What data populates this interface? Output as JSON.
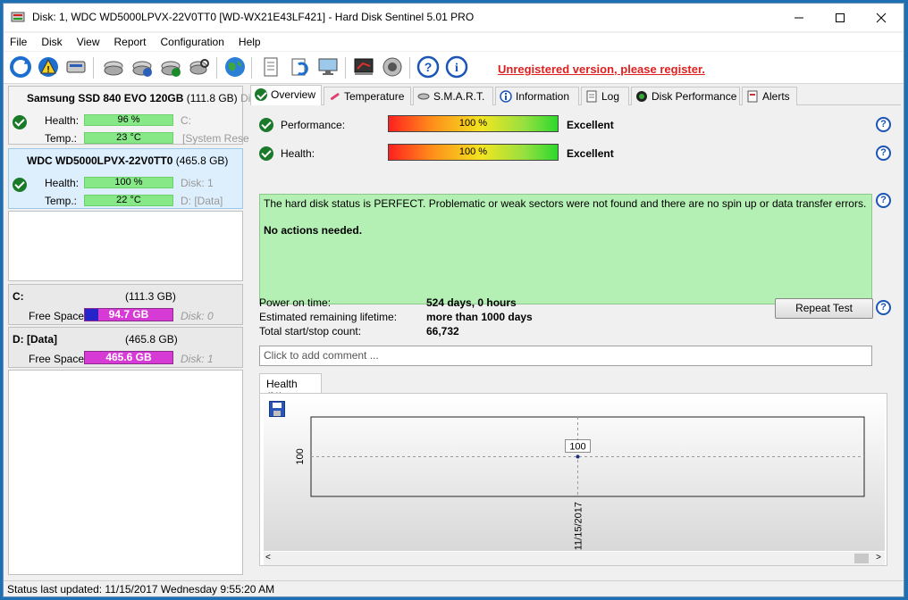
{
  "window": {
    "title": "Disk: 1, WDC WD5000LPVX-22V0TT0 [WD-WX21E43LF421]  -  Hard Disk Sentinel 5.01 PRO"
  },
  "menu": [
    "File",
    "Disk",
    "View",
    "Report",
    "Configuration",
    "Help"
  ],
  "toolbar": {
    "icons": [
      "refresh-icon",
      "warning-icon",
      "disk-icon",
      "disk-test-icon",
      "disk-info-icon",
      "disk-check-icon",
      "disk-search-icon",
      "globe-icon",
      "report-icon",
      "send-icon",
      "network-icon",
      "benchmark-icon",
      "speaker-icon",
      "help-icon",
      "info-icon"
    ],
    "unregistered": "Unregistered version, please register."
  },
  "disks": [
    {
      "name": "Samsung SSD 840 EVO 120GB",
      "size": "(111.8 GB)",
      "more": "Di",
      "health_label": "Health:",
      "health": "96 %",
      "health_volume": "C:",
      "temp_label": "Temp.:",
      "temp": "23 °C",
      "temp_volume": "[System Rese"
    },
    {
      "name": "WDC WD5000LPVX-22V0TT0",
      "size": "(465.8 GB)",
      "health_label": "Health:",
      "health": "100 %",
      "health_volume": "Disk: 1",
      "temp_label": "Temp.:",
      "temp": "22 °C",
      "temp_volume": "D: [Data]"
    }
  ],
  "volumes": [
    {
      "name": "C:",
      "size": "(111.3 GB)",
      "free_label": "Free Space",
      "free": "94.7 GB",
      "free_fraction": 0.15,
      "disk": "Disk: 0"
    },
    {
      "name": "D: [Data]",
      "size": "(465.8 GB)",
      "free_label": "Free Space",
      "free": "465.6 GB",
      "free_fraction": 0.0,
      "disk": "Disk: 1"
    }
  ],
  "tabs": [
    "Overview",
    "Temperature",
    "S.M.A.R.T.",
    "Information",
    "Log",
    "Disk Performance",
    "Alerts"
  ],
  "overview": {
    "performance_label": "Performance:",
    "performance": "100 %",
    "performance_rating": "Excellent",
    "health_label": "Health:",
    "health": "100 %",
    "health_rating": "Excellent",
    "status_text": "The hard disk status is PERFECT. Problematic or weak sectors were not found and there are no spin up or data transfer errors.",
    "status_action": "No actions needed.",
    "power_on_label": "Power on time:",
    "power_on": "524 days, 0 hours",
    "lifetime_label": "Estimated remaining lifetime:",
    "lifetime": "more than 1000 days",
    "startstop_label": "Total start/stop count:",
    "startstop": "66,732",
    "repeat_test": "Repeat Test",
    "comment_placeholder": "Click to add comment ...",
    "chart_tab": "Health (%)",
    "help": "?"
  },
  "chart_data": {
    "type": "line",
    "x": [
      "11/15/2017"
    ],
    "series": [
      {
        "values": [
          100
        ]
      }
    ],
    "ylabel": "",
    "xlabel": "",
    "y_tick_labels": [
      "100"
    ],
    "point_labels": [
      "100"
    ],
    "grid": true
  },
  "statusbar": "Status last updated: 11/15/2017 Wednesday 9:55:20 AM"
}
